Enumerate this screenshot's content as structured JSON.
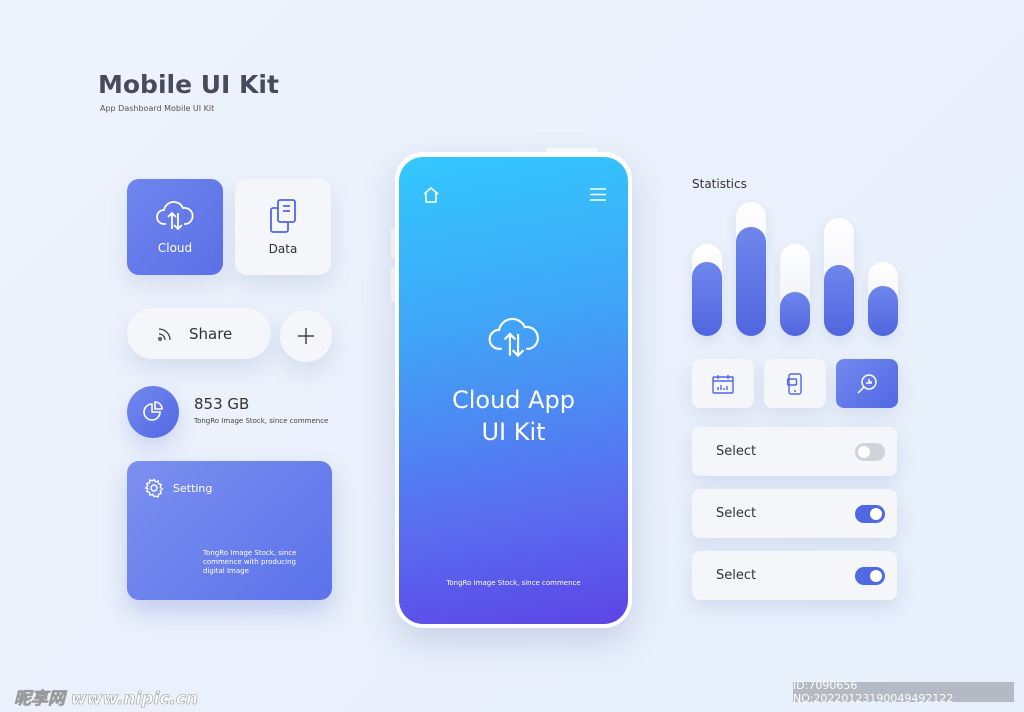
{
  "header": {
    "title": "Mobile UI Kit",
    "subtitle": "App Dashboard Mobile UI Kit"
  },
  "tiles": [
    {
      "label": "Cloud",
      "icon": "cloud-sync-icon",
      "active": true
    },
    {
      "label": "Data",
      "icon": "documents-icon",
      "active": false
    }
  ],
  "share": {
    "label": "Share",
    "icon": "rss-icon",
    "add_icon": "plus-icon"
  },
  "storage": {
    "value": "853 GB",
    "caption": "TongRo Image Stock, since commence",
    "icon": "pie-chart-icon"
  },
  "setting": {
    "label": "Setting",
    "icon": "gear-icon",
    "text": "TongRo Image Stock, since commence with producing digital Image"
  },
  "phone": {
    "home_icon": "home-icon",
    "menu_icon": "menu-icon",
    "title_line1": "Cloud App",
    "title_line2": "UI Kit",
    "footer": "TongRo Image Stock, since commence"
  },
  "statistics": {
    "label": "Statistics",
    "bars": [
      {
        "track": 69,
        "value": 55
      },
      {
        "track": 100,
        "value": 81
      },
      {
        "track": 69,
        "value": 33
      },
      {
        "track": 88,
        "value": 53
      },
      {
        "track": 55,
        "value": 37
      }
    ]
  },
  "icon_buttons": [
    {
      "icon": "calendar-chart-icon",
      "active": false
    },
    {
      "icon": "mobile-chat-icon",
      "active": false
    },
    {
      "icon": "search-chart-icon",
      "active": true
    }
  ],
  "selects": [
    {
      "label": "Select",
      "on": false
    },
    {
      "label": "Select",
      "on": true
    },
    {
      "label": "Select",
      "on": true
    }
  ],
  "colors": {
    "accent": "#5b72ec",
    "gradient_top": "#33c8fd",
    "gradient_bottom": "#5b45e6"
  },
  "watermark": {
    "logo": "昵享网 www.nipic.cn",
    "id": "ID:7090656 NO:20220123190049492122"
  }
}
